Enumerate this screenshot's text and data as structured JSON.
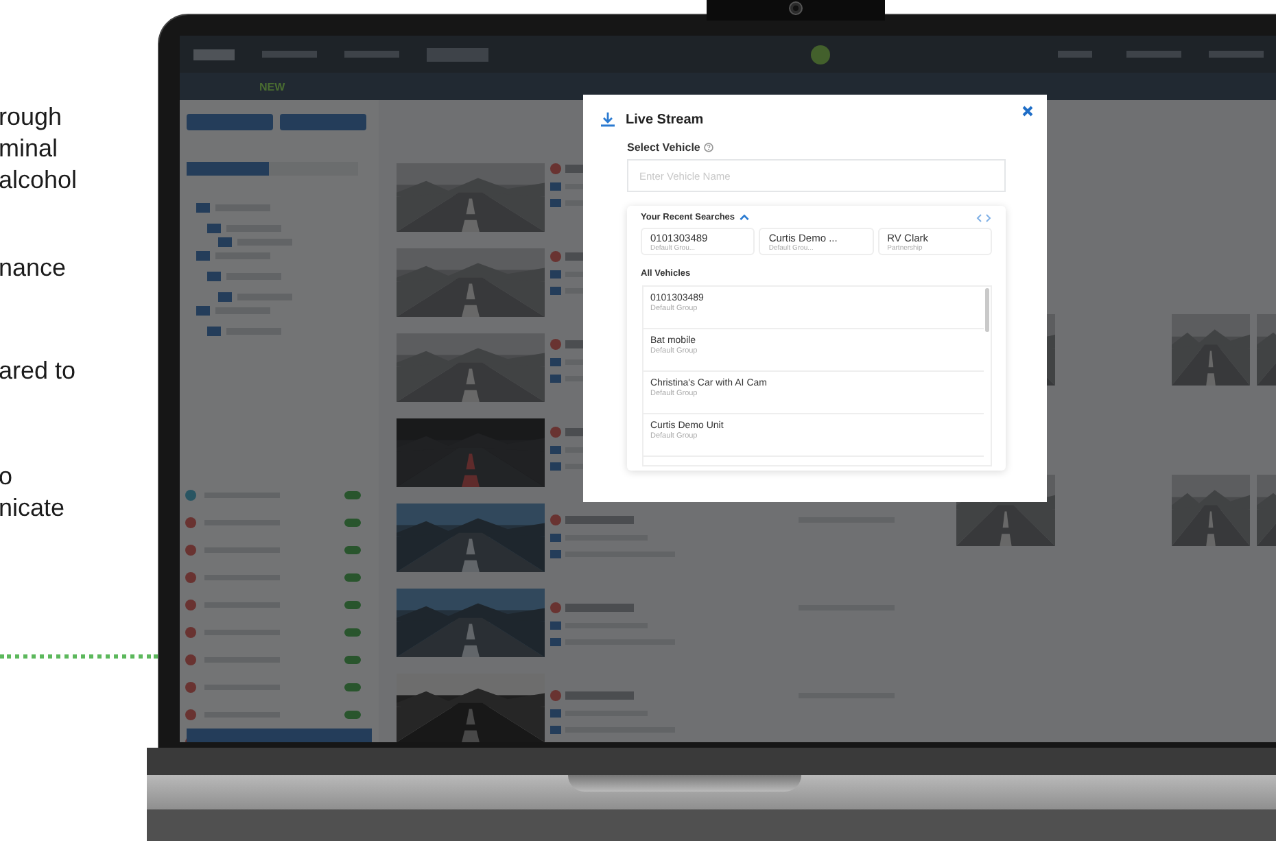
{
  "side_copy": [
    {
      "lines": [
        "rough",
        "minal",
        "alcohol"
      ]
    },
    {
      "lines": [
        "nance"
      ]
    },
    {
      "lines": [
        "ared to"
      ]
    },
    {
      "lines": [
        "o",
        "nicate"
      ]
    }
  ],
  "app": {
    "nav_badge": "NEW"
  },
  "modal": {
    "title": "Live Stream",
    "field_label": "Select Vehicle",
    "search": {
      "placeholder": "Enter Vehicle Name"
    },
    "recent": {
      "title": "Your Recent Searches",
      "expanded": true,
      "items": [
        {
          "name": "0101303489",
          "group": "Default Grou..."
        },
        {
          "name": "Curtis Demo ...",
          "group": "Default Grou..."
        },
        {
          "name": "RV Clark",
          "group": "Partnership"
        }
      ]
    },
    "all_title": "All Vehicles",
    "vehicles": [
      {
        "name": "0101303489",
        "group": "Default Group"
      },
      {
        "name": "Bat mobile",
        "group": "Default Group"
      },
      {
        "name": "Christina's Car with AI Cam",
        "group": "Default Group"
      },
      {
        "name": "Curtis Demo Unit",
        "group": "Default Group"
      }
    ]
  }
}
